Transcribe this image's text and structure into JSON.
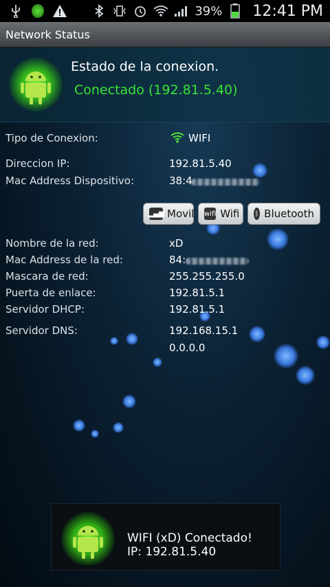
{
  "status_bar": {
    "icons": [
      "usb-icon",
      "app-icon",
      "warning-icon",
      "bluetooth-icon",
      "vibrate-icon",
      "alarm-icon",
      "wifi-icon",
      "signal-icon",
      "battery-icon"
    ],
    "battery": "39%",
    "time": "12:41 PM"
  },
  "app": {
    "title": "Network Status"
  },
  "header": {
    "title": "Estado de la conexion.",
    "status": "Conectado (192.81.5.40)"
  },
  "connection": {
    "tipo_label": "Tipo de Conexion:",
    "tipo_value": "WIFI",
    "ip_label": "Direccion IP:",
    "ip_value": "192.81.5.40",
    "mac_label": "Mac Address Dispositivo:",
    "mac_value": "38:4"
  },
  "buttons": {
    "movil": "Movil",
    "wifi": "Wifi",
    "bluetooth": "Bluetooth"
  },
  "network": {
    "name_label": "Nombre de la red:",
    "name_value": "xD",
    "mac_label": "Mac Address de la red:",
    "mac_value": "84:",
    "mask_label": "Mascara de red:",
    "mask_value": "255.255.255.0",
    "gateway_label": "Puerta de enlace:",
    "gateway_value": "192.81.5.1",
    "dhcp_label": "Servidor DHCP:",
    "dhcp_value": "192.81.5.1",
    "dns_label": "Servidor DNS:",
    "dns_value1": "192.168.15.1",
    "dns_value2": "0.0.0.0"
  },
  "toast": {
    "line1": "WIFI (xD) Conectado!",
    "line2": "IP: 192.81.5.40"
  }
}
